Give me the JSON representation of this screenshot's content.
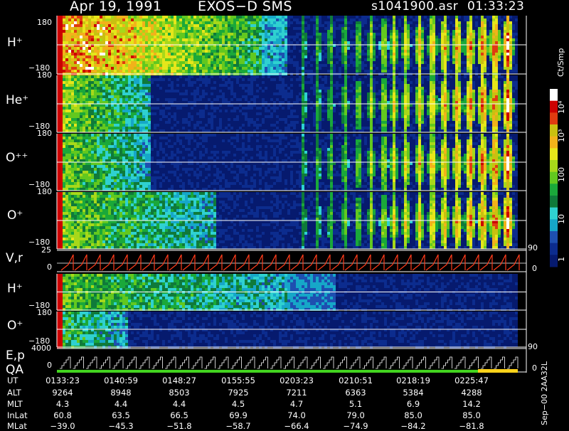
{
  "header": {
    "date": "Apr 19, 1991",
    "instrument": "EXOS−D SMS",
    "file": "s1041900.asr",
    "time": "01:33:23"
  },
  "colorbar": {
    "unit": "Ct/Smp",
    "labels": [
      {
        "text": "10⁴",
        "value": 10000
      },
      {
        "text": "10³",
        "value": 1000
      },
      {
        "text": "100",
        "value": 100
      },
      {
        "text": "10",
        "value": 10
      },
      {
        "text": "1",
        "value": 1
      }
    ]
  },
  "side_note": "Sep−00  2AA32L",
  "chart_data": [
    {
      "type": "heatmap",
      "panel": "H+",
      "label": "H⁺",
      "y_ticks": [
        "180",
        "−180"
      ],
      "ylim": [
        -180,
        180
      ]
    },
    {
      "type": "heatmap",
      "panel": "He+",
      "label": "He⁺",
      "y_ticks": [
        "180",
        "−180"
      ],
      "ylim": [
        -180,
        180
      ]
    },
    {
      "type": "heatmap",
      "panel": "O++",
      "label": "O⁺⁺",
      "y_ticks": [
        "180",
        "−180"
      ],
      "ylim": [
        -180,
        180
      ]
    },
    {
      "type": "heatmap",
      "panel": "O+",
      "label": "O⁺",
      "y_ticks": [
        "180",
        "−180"
      ],
      "ylim": [
        -180,
        180
      ]
    },
    {
      "type": "line",
      "panel": "V,r",
      "label": "V,r",
      "y_ticks": [
        "25",
        "0"
      ],
      "right_ticks": [
        "90",
        "0"
      ]
    },
    {
      "type": "heatmap",
      "panel": "H+ (2)",
      "label": "H⁺",
      "y_ticks": [
        "−180"
      ]
    },
    {
      "type": "heatmap",
      "panel": "O+ (2)",
      "label": "O⁺",
      "y_ticks": [
        "180",
        "−180"
      ],
      "right_ticks": [
        "90"
      ]
    },
    {
      "type": "line",
      "panel": "E,p / QA",
      "labels": [
        "E,p",
        "QA"
      ],
      "y_ticks": [
        "4000",
        "0"
      ],
      "right_ticks": [
        "0"
      ]
    }
  ],
  "ephemeris": {
    "rows": [
      {
        "label": "UT",
        "values": [
          "0133:23",
          "0140:59",
          "0148:27",
          "0155:55",
          "0203:23",
          "0210:51",
          "0218:19",
          "0225:47"
        ]
      },
      {
        "label": "ALT",
        "values": [
          "9264",
          "8948",
          "8503",
          "7925",
          "7211",
          "6363",
          "5384",
          "4288"
        ]
      },
      {
        "label": "MLT",
        "values": [
          "4.3",
          "4.4",
          "4.4",
          "4.5",
          "4.7",
          "5.1",
          "6.9",
          "14.2"
        ]
      },
      {
        "label": "InLat",
        "values": [
          "60.8",
          "63.5",
          "66.5",
          "69.9",
          "74.0",
          "79.0",
          "85.0",
          "85.0"
        ]
      },
      {
        "label": "MLat",
        "values": [
          "−39.0",
          "−45.3",
          "−51.8",
          "−58.7",
          "−66.4",
          "−74.9",
          "−84.2",
          "−81.8"
        ]
      }
    ]
  }
}
